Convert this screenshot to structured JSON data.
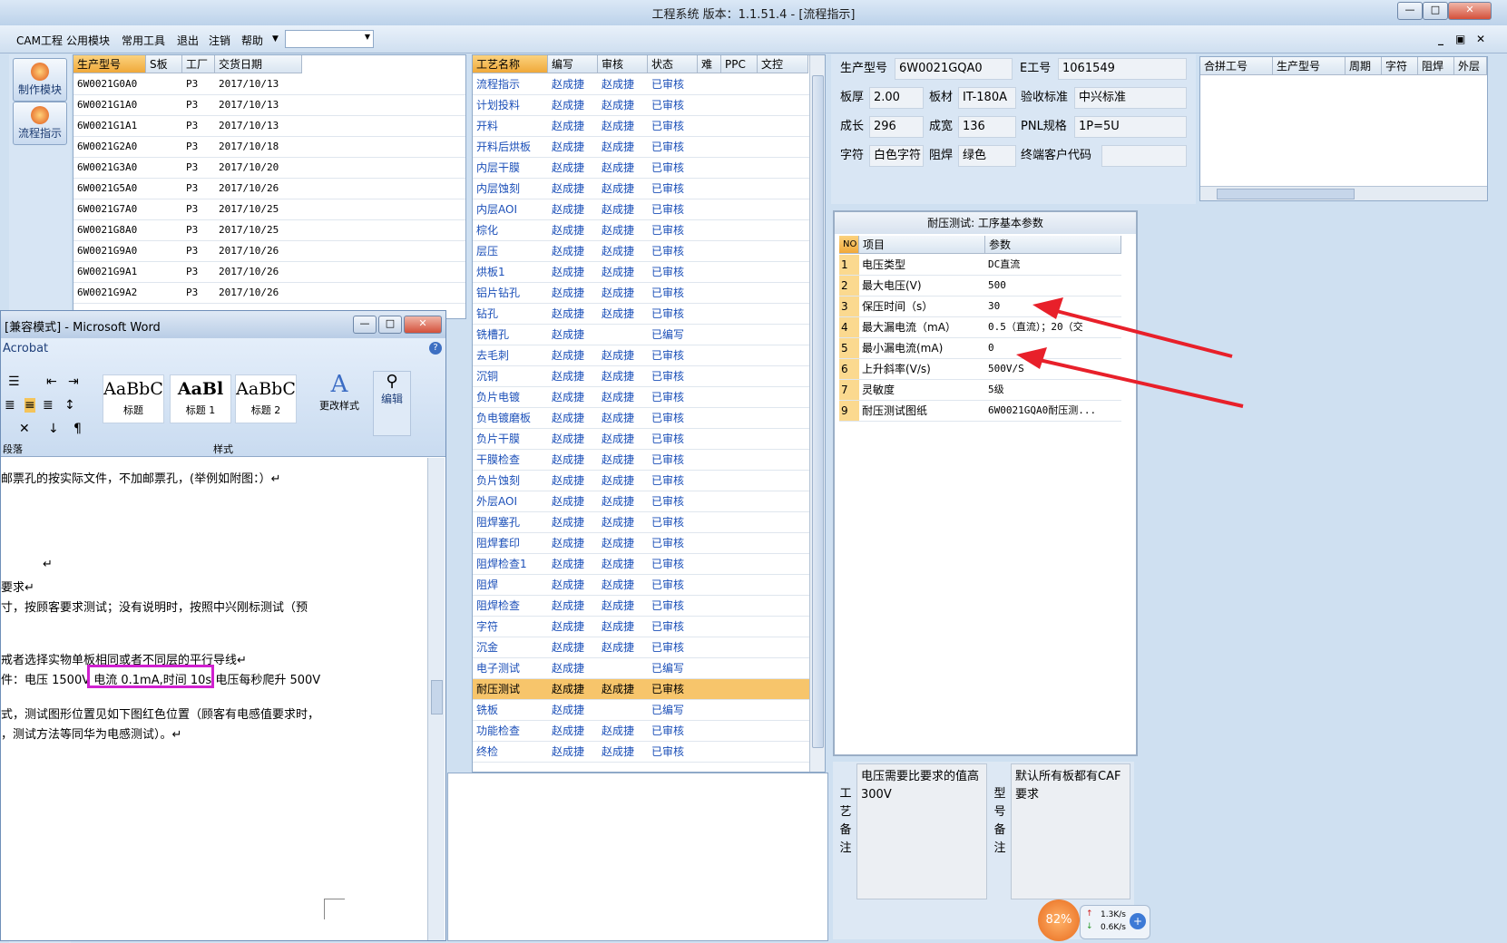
{
  "app": {
    "title": "工程系统   版本：1.1.51.4 - [流程指示]",
    "win_buttons": [
      "—",
      "□",
      "✕"
    ]
  },
  "menu": {
    "items": [
      "CAM工程",
      "公用模块",
      "常用工具",
      "退出",
      "注销",
      "帮助"
    ],
    "dropdown_value": "",
    "mdi_buttons": [
      "_",
      "▣",
      "✕"
    ]
  },
  "left_toolbar": {
    "buttons": [
      "制作模块",
      "流程指示"
    ]
  },
  "orders": {
    "headers": [
      "生产型号",
      "S板",
      "工厂",
      "交货日期"
    ],
    "rows": [
      [
        "6W0021G0A0",
        "",
        "P3",
        "2017/10/13"
      ],
      [
        "6W0021G1A0",
        "",
        "P3",
        "2017/10/13"
      ],
      [
        "6W0021G1A1",
        "",
        "P3",
        "2017/10/13"
      ],
      [
        "6W0021G2A0",
        "",
        "P3",
        "2017/10/18"
      ],
      [
        "6W0021G3A0",
        "",
        "P3",
        "2017/10/20"
      ],
      [
        "6W0021G5A0",
        "",
        "P3",
        "2017/10/26"
      ],
      [
        "6W0021G7A0",
        "",
        "P3",
        "2017/10/25"
      ],
      [
        "6W0021G8A0",
        "",
        "P3",
        "2017/10/25"
      ],
      [
        "6W0021G9A0",
        "",
        "P3",
        "2017/10/26"
      ],
      [
        "6W0021G9A1",
        "",
        "P3",
        "2017/10/26"
      ],
      [
        "6W0021G9A2",
        "",
        "P3",
        "2017/10/26"
      ]
    ]
  },
  "process": {
    "headers": [
      "工艺名称",
      "编写",
      "审核",
      "状态",
      "难",
      "PPC",
      "文控"
    ],
    "rows": [
      [
        "流程指示",
        "赵成捷",
        "赵成捷",
        "已审核"
      ],
      [
        "计划投料",
        "赵成捷",
        "赵成捷",
        "已审核"
      ],
      [
        "开料",
        "赵成捷",
        "赵成捷",
        "已审核"
      ],
      [
        "开料后烘板",
        "赵成捷",
        "赵成捷",
        "已审核"
      ],
      [
        "内层干膜",
        "赵成捷",
        "赵成捷",
        "已审核"
      ],
      [
        "内层蚀刻",
        "赵成捷",
        "赵成捷",
        "已审核"
      ],
      [
        "内层AOI",
        "赵成捷",
        "赵成捷",
        "已审核"
      ],
      [
        "棕化",
        "赵成捷",
        "赵成捷",
        "已审核"
      ],
      [
        "层压",
        "赵成捷",
        "赵成捷",
        "已审核"
      ],
      [
        "烘板1",
        "赵成捷",
        "赵成捷",
        "已审核"
      ],
      [
        "铝片钻孔",
        "赵成捷",
        "赵成捷",
        "已审核"
      ],
      [
        "钻孔",
        "赵成捷",
        "赵成捷",
        "已审核"
      ],
      [
        "铣槽孔",
        "赵成捷",
        "",
        "已编写"
      ],
      [
        "去毛刺",
        "赵成捷",
        "赵成捷",
        "已审核"
      ],
      [
        "沉铜",
        "赵成捷",
        "赵成捷",
        "已审核"
      ],
      [
        "负片电镀",
        "赵成捷",
        "赵成捷",
        "已审核"
      ],
      [
        "负电镀磨板",
        "赵成捷",
        "赵成捷",
        "已审核"
      ],
      [
        "负片干膜",
        "赵成捷",
        "赵成捷",
        "已审核"
      ],
      [
        "干膜检查",
        "赵成捷",
        "赵成捷",
        "已审核"
      ],
      [
        "负片蚀刻",
        "赵成捷",
        "赵成捷",
        "已审核"
      ],
      [
        "外层AOI",
        "赵成捷",
        "赵成捷",
        "已审核"
      ],
      [
        "阻焊塞孔",
        "赵成捷",
        "赵成捷",
        "已审核"
      ],
      [
        "阻焊套印",
        "赵成捷",
        "赵成捷",
        "已审核"
      ],
      [
        "阻焊检查1",
        "赵成捷",
        "赵成捷",
        "已审核"
      ],
      [
        "阻焊",
        "赵成捷",
        "赵成捷",
        "已审核"
      ],
      [
        "阻焊检查",
        "赵成捷",
        "赵成捷",
        "已审核"
      ],
      [
        "字符",
        "赵成捷",
        "赵成捷",
        "已审核"
      ],
      [
        "沉金",
        "赵成捷",
        "赵成捷",
        "已审核"
      ],
      [
        "电子测试",
        "赵成捷",
        "",
        "已编写"
      ],
      [
        "耐压测试",
        "赵成捷",
        "赵成捷",
        "已审核"
      ],
      [
        "铣板",
        "赵成捷",
        "",
        "已编写"
      ],
      [
        "功能检查",
        "赵成捷",
        "赵成捷",
        "已审核"
      ],
      [
        "终检",
        "赵成捷",
        "赵成捷",
        "已审核"
      ]
    ],
    "selected_index": 29
  },
  "info": {
    "labels": {
      "model": "生产型号",
      "eno": "E工号",
      "thick": "板厚",
      "material": "板材",
      "standard": "验收标准",
      "len": "成长",
      "width": "成宽",
      "pnl": "PNL规格",
      "char": "字符",
      "mask": "阻焊",
      "endcust": "终端客户代码"
    },
    "values": {
      "model": "6W0021GQA0",
      "eno": "1061549",
      "thick": "2.00",
      "material": "IT-180A",
      "standard": "中兴标准",
      "len": "296",
      "width": "136",
      "pnl": "1P=5U",
      "char": "白色字符",
      "mask": "绿色",
      "endcust": ""
    }
  },
  "merge": {
    "headers": [
      "合拼工号",
      "生产型号",
      "周期",
      "字符",
      "阻焊",
      "外层"
    ]
  },
  "params": {
    "title": "耐压测试: 工序基本参数",
    "headers": [
      "NO",
      "项目",
      "参数"
    ],
    "rows": [
      [
        "1",
        "电压类型",
        "DC直流"
      ],
      [
        "2",
        "最大电压(V)",
        "500"
      ],
      [
        "3",
        "保压时间（s）",
        "30"
      ],
      [
        "4",
        "最大漏电流（mA）",
        "0.5（直流）；20（交"
      ],
      [
        "5",
        "最小漏电流(mA)",
        "0"
      ],
      [
        "6",
        "上升斜率(V/s)",
        "500V/S"
      ],
      [
        "7",
        "灵敏度",
        "5级"
      ],
      [
        "9",
        "耐压测试图纸",
        "6W0021GQA0耐压测..."
      ]
    ]
  },
  "remarks": {
    "process_label": "工艺备注",
    "process_text": "电压需要比要求的值高300V",
    "model_label": "型号备注",
    "model_text": "默认所有板都有CAF要求"
  },
  "word": {
    "title": "[兼容模式] - Microsoft Word",
    "acrobat": "Acrobat",
    "styles": [
      {
        "preview": "AaBbC",
        "name": "标题"
      },
      {
        "preview": "AaBl",
        "name": "标题 1"
      },
      {
        "preview": "AaBbC",
        "name": "标题 2"
      }
    ],
    "change_styles": "更改样式",
    "edit": "编辑",
    "group_paragraph": "段落",
    "group_styles": "样式",
    "lines": [
      "邮票孔的按实际文件，不加邮票孔，(举例如附图：）↵",
      "↵",
      "要求↵",
      "寸，按顾客要求测试；没有说明时，按照中兴刚标测试（预",
      "戒者选择实物单板相同或者不同层的平行导线↵",
      "件：电压 1500V 电流 0.1mA,时间 10s,电压每秒爬升 500V",
      "式，测试图形位置见如下图红色位置（顾客有电感值要求时，",
      "，测试方法等同华为电感测试）。↵"
    ]
  },
  "netmeter": {
    "percent": "82%",
    "up": "1.3K/s",
    "down": "0.6K/s"
  },
  "colors": {
    "selected_row": "#f7c56b",
    "header_process": "#f5b547",
    "annotation_arrow": "#e8202a",
    "highlight_box": "#d020d0"
  }
}
